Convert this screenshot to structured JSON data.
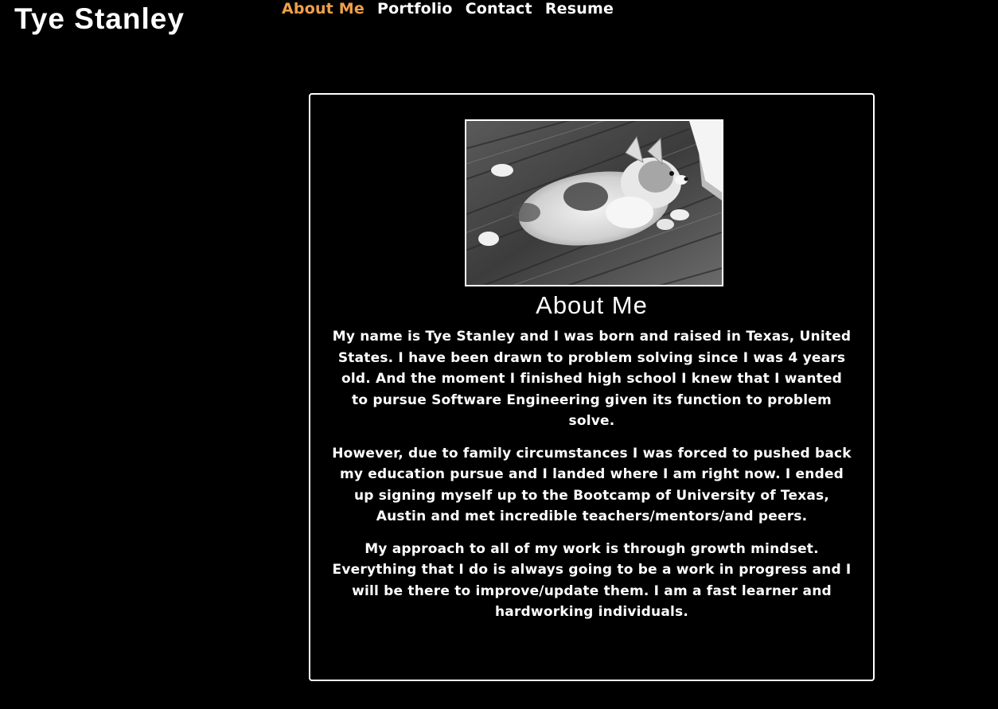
{
  "header": {
    "site_title": "Tye Stanley"
  },
  "nav": {
    "items": [
      {
        "label": "About Me",
        "active": true
      },
      {
        "label": "Portfolio",
        "active": false
      },
      {
        "label": "Contact",
        "active": false
      },
      {
        "label": "Resume",
        "active": false
      }
    ],
    "active_color": "#f0a04b"
  },
  "about": {
    "photo_alt": "black and white photo of a corgi puppy lying on a wooden floor",
    "heading": "About Me",
    "paragraphs": [
      "My name is Tye Stanley and I was born and raised in Texas, United States. I have been drawn to problem solving since I was 4 years old. And the moment I finished high school I knew that I wanted to pursue Software Engineering given its function to problem solve.",
      "However, due to family circumstances I was forced to pushed back my education pursue and I landed where I am right now. I ended up signing myself up to the Bootcamp of University of Texas, Austin and met incredible teachers/mentors/and peers.",
      "My approach to all of my work is through growth mindset. Everything that I do is always going to be a work in progress and I will be there to improve/update them. I am a fast learner and hardworking individuals."
    ]
  },
  "colors": {
    "background": "#000000",
    "text": "#ffffff",
    "accent": "#f0a04b"
  }
}
